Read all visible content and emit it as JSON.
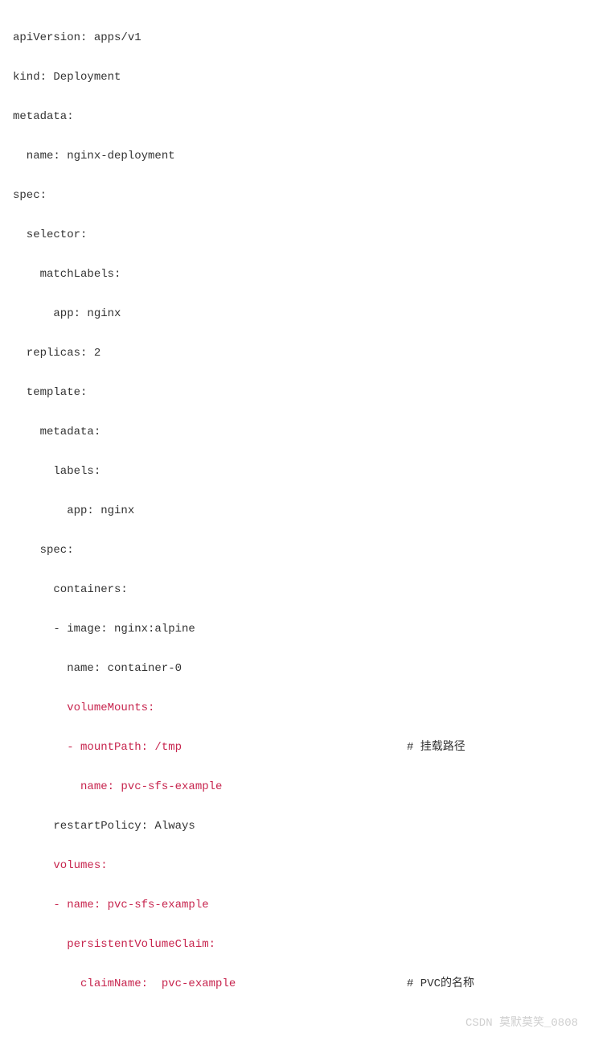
{
  "lines": {
    "l1": "apiVersion: apps/v1",
    "l2": "kind: Deployment",
    "l3": "metadata:",
    "l4": "  name: nginx-deployment",
    "l5": "spec:",
    "l6": "  selector:",
    "l7": "    matchLabels:",
    "l8": "      app: nginx",
    "l9": "  replicas: 2",
    "l10": "  template:",
    "l11": "    metadata:",
    "l12": "      labels:",
    "l13": "        app: nginx",
    "l14": "    spec:",
    "l15": "      containers:",
    "l16": "      - image: nginx:alpine",
    "l17": "        name: container-0",
    "l18": "        volumeMounts:",
    "l19": "        - mountPath: /tmp",
    "l19c": "# 挂载路径",
    "l20": "          name: pvc-sfs-example",
    "l21": "      restartPolicy: Always",
    "l22": "      volumes:",
    "l23": "      - name: pvc-sfs-example",
    "l24": "        persistentVolumeClaim:",
    "l25": "          claimName:  pvc-example",
    "l25c": "# PVC的名称"
  },
  "watermark": "CSDN 莫默莫笑_0808"
}
